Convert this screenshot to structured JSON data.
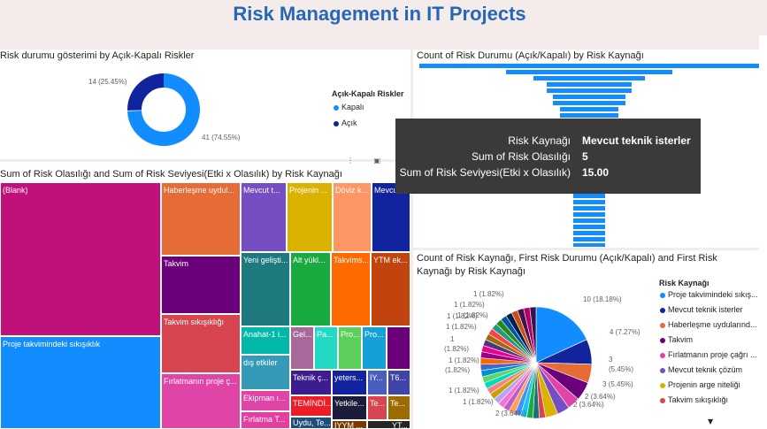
{
  "header": {
    "title": "Risk Management in IT Projects"
  },
  "donut": {
    "title": "Risk durumu gösterimi by Açık-Kapalı Riskler",
    "legend_title": "Açık-Kapalı Riskler",
    "legend": [
      {
        "label": "Kapalı",
        "color": "#118dff"
      },
      {
        "label": "Açık",
        "color": "#12239e"
      }
    ],
    "slice_labels": {
      "kapali": "41 (74.55%)",
      "acik": "14 (25.45%)"
    }
  },
  "funnel": {
    "title": "Count of Risk Durumu (Açık/Kapalı) by Risk Kaynağı"
  },
  "tooltip": {
    "rows": [
      {
        "key": "Risk Kaynağı",
        "value": "Mevcut teknik isterler"
      },
      {
        "key": "Sum of Risk Olasılığı",
        "value": "5"
      },
      {
        "key": "Sum of Risk Seviyesi(Etki x Olasılık)",
        "value": "15.00"
      }
    ]
  },
  "treemap": {
    "title": "Sum of Risk Olasılığı and Sum of Risk Seviyesi(Etki x Olasılık) by Risk Kaynağı",
    "labels": {
      "blank": "(Blank)",
      "proje_takvim": "Proje takvimindeki sıkışıklık",
      "haberlesme": "Haberleşme uydul...",
      "takvim": "Takvim",
      "takvim_sikisikligi": "Takvim sıkışıklığı",
      "firlatmanin": "Fırlatmanın proje ç...",
      "mevcut_t": "Mevcut t...",
      "projenin": "Projenin ...",
      "doviz": "Döviz k...",
      "mevcu": "Mevcu",
      "yeni": "Yeni gelişti...",
      "alt": "Alt yükl...",
      "takvims": "Takvims...",
      "ytm": "YTM ek...",
      "anahat": "Anahat-1 i...",
      "gel": "Gel...",
      "pa": "Pa...",
      "pro1": "Pro...",
      "pro2": "Pro...",
      "dis": "dış etkiler",
      "teknik": "Teknik ç...",
      "yeters": "yeters...",
      "iy": "IY...",
      "t6": "T6...",
      "ekipman": "Ekipman ı...",
      "temind": "TEMİNDİ...",
      "yetkile": "Yetkile...",
      "te1": "Te...",
      "te2": "Te...",
      "firlatma_t": "Fırlatma T...",
      "uydu": "Uydu, Te...",
      "iyym": "IYYM ...",
      "yt": "YT..."
    }
  },
  "pie": {
    "title_line1": "Count of Risk Kaynağı, First Risk Durumu (Açık/Kapalı) and First Risk",
    "title_line2": "Kaynağı by Risk Kaynağı",
    "legend_title": "Risk Kaynağı",
    "legend": [
      {
        "label": "Proje takvimindeki sıkış...",
        "color": "#118dff"
      },
      {
        "label": "Mevcut teknik isterler",
        "color": "#12239e"
      },
      {
        "label": "Haberleşme uydularınd...",
        "color": "#e66c37"
      },
      {
        "label": "Takvim",
        "color": "#6b007b"
      },
      {
        "label": "Fırlatmanın proje çağrı ...",
        "color": "#e044a7"
      },
      {
        "label": "Mevcut teknik çözüm",
        "color": "#744ec2"
      },
      {
        "label": "Projenin arge niteliği",
        "color": "#d9b300"
      },
      {
        "label": "Takvim sıkışıklığı",
        "color": "#d64550"
      }
    ],
    "labels": {
      "l10": "10 (18.18%)",
      "l4": "4 (7.27%)",
      "l3a": "3",
      "l3a2": "(5.45%)",
      "l3b": "3 (5.45%)",
      "l2a": "2 (3.64%)",
      "l2b": "2 (3.64%)",
      "l2c": "2 (3.64%)",
      "l1": "1 (1.82%)",
      "l1a": "1",
      "l1b": "(1.82%)"
    }
  }
}
